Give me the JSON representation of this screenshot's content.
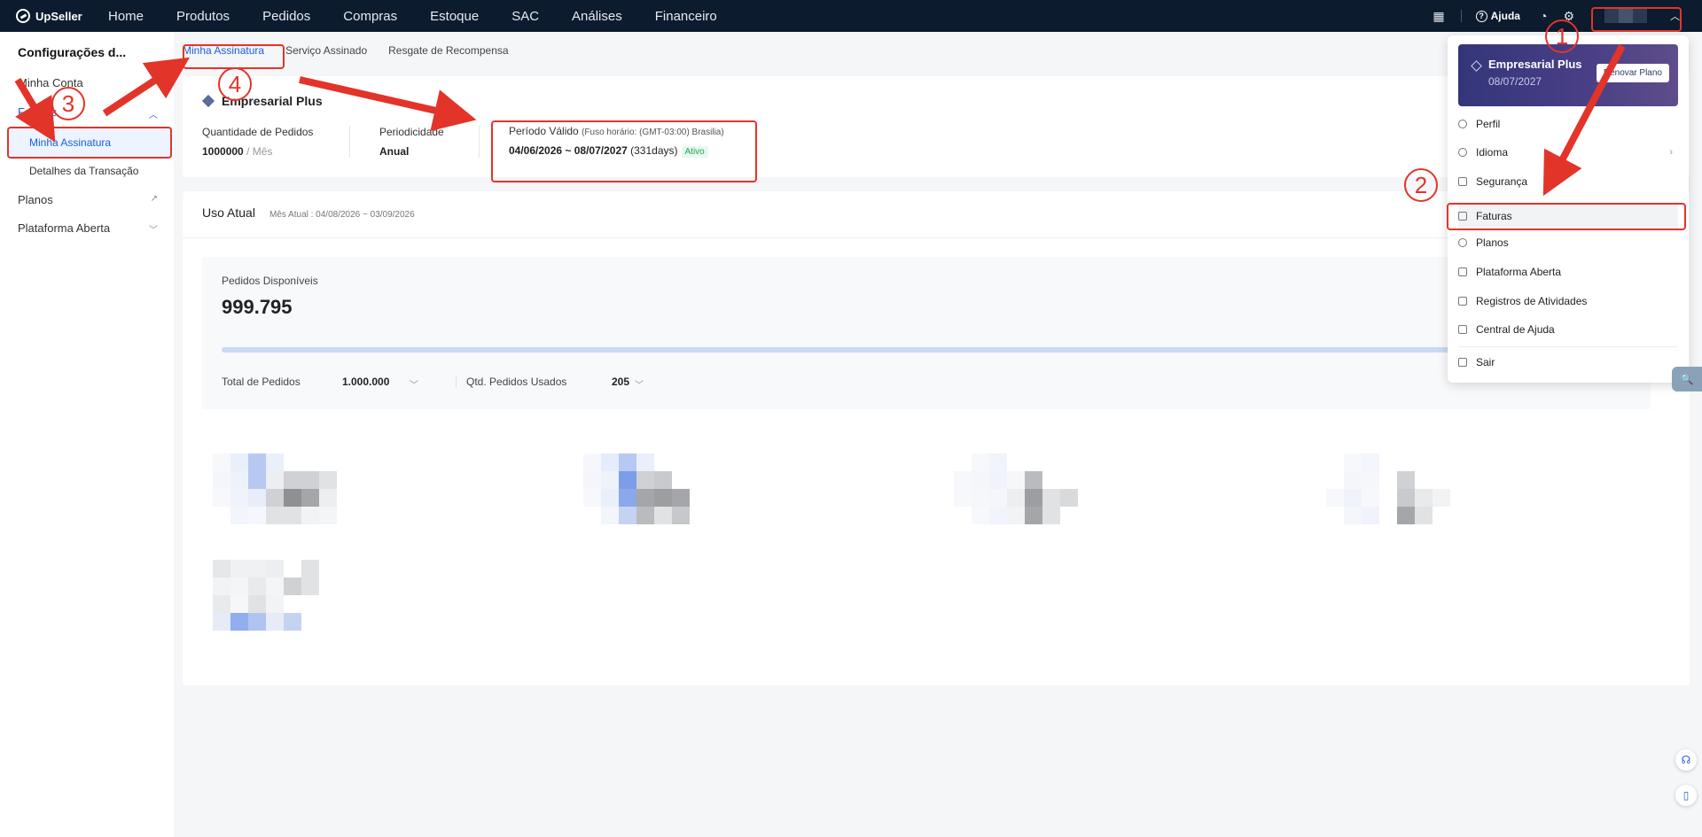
{
  "topnav": {
    "brand": "UpSeller",
    "items": [
      "Home",
      "Produtos",
      "Pedidos",
      "Compras",
      "Estoque",
      "SAC",
      "Análises",
      "Financeiro"
    ],
    "help_label": "Ajuda"
  },
  "sidebar": {
    "title": "Configurações d...",
    "items": [
      {
        "label": "Minha Conta"
      },
      {
        "label": "Faturas"
      },
      {
        "label": "Planos"
      },
      {
        "label": "Plataforma Aberta"
      }
    ],
    "sub_items": [
      "Minha Assinatura",
      "Detalhes da Transação"
    ]
  },
  "tabs": [
    "Minha Assinatura",
    "Serviço Assinado",
    "Resgate de Recompensa"
  ],
  "subscription": {
    "plan": "Empresarial Plus",
    "qty_label": "Quantidade de Pedidos",
    "qty_value": "1000000",
    "qty_unit": "/ Mês",
    "period_label": "Periodicidade",
    "period_value": "Anual",
    "valid_label": "Período Válido",
    "timezone": "(Fuso horário: (GMT-03:00) Brasilia)",
    "valid_value": "04/06/2026 ~ 08/07/2027",
    "days": "(331days)",
    "status": "Ativo"
  },
  "usage": {
    "title": "Uso Atual",
    "month": "Mês Atual : 04/08/2026 ~ 03/09/2026",
    "available_label": "Pedidos Disponíveis",
    "available_value": "999.795",
    "progress": 0.9998,
    "total_label": "Total de Pedidos",
    "total_value": "1.000.000",
    "used_label": "Qtd. Pedidos Usados",
    "used_value": "205"
  },
  "dropdown": {
    "promo_title": "Empresarial Plus",
    "promo_date": "08/07/2027",
    "renew_label": "Renovar Plano",
    "items": [
      "Perfil",
      "Idioma",
      "Segurança",
      "Faturas",
      "Planos",
      "Plataforma Aberta",
      "Registros de Atividades",
      "Central de Ajuda",
      "Sair"
    ]
  },
  "annotations": [
    "1",
    "2",
    "3",
    "4"
  ],
  "colors": {
    "accent": "#1a5de4",
    "annotation": "#e3342a",
    "nav_bg": "#0d1b2e"
  }
}
